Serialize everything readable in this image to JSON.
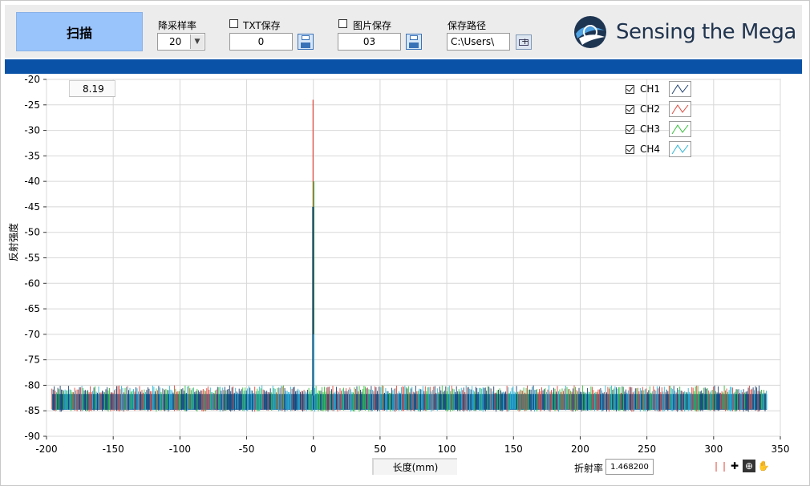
{
  "toolbar": {
    "scan_label": "扫描",
    "downsample_label": "降采样率",
    "downsample_value": "20",
    "txt_save_label": "TXT保存",
    "txt_save_checked": false,
    "txt_counter": "0",
    "img_save_label": "图片保存",
    "img_save_checked": false,
    "img_counter": "03",
    "path_label": "保存路径",
    "path_value": "C:\\Users\\"
  },
  "logo": {
    "text": "Sensing the Mega"
  },
  "colors": {
    "ch1": "#1f3f6e",
    "ch2": "#e0483c",
    "ch3": "#35c03a",
    "ch4": "#2bb6d8",
    "band": "#1d6fa8",
    "header_bar": "#0a52a8",
    "scan_button": "#99c3fb"
  },
  "plot": {
    "cursor_value": "8.19",
    "refractive_index_label": "折射率",
    "refractive_index_value": "1.468200",
    "palette_icons": [
      "cursor-icon",
      "crosshair-icon",
      "zoom-icon",
      "pan-hand-icon"
    ]
  },
  "legend": [
    {
      "label": "CH1",
      "checked": true
    },
    {
      "label": "CH2",
      "checked": true
    },
    {
      "label": "CH3",
      "checked": true
    },
    {
      "label": "CH4",
      "checked": true
    }
  ],
  "chart_data": {
    "type": "line",
    "xlabel": "长度(mm)",
    "ylabel": "反射强度",
    "xlim": [
      -200,
      350
    ],
    "ylim": [
      -90,
      -20
    ],
    "xticks": [
      -200,
      -150,
      -100,
      -50,
      0,
      50,
      100,
      150,
      200,
      250,
      300,
      350
    ],
    "yticks": [
      -20,
      -25,
      -30,
      -35,
      -40,
      -45,
      -50,
      -55,
      -60,
      -65,
      -70,
      -75,
      -80,
      -85,
      -90
    ],
    "grid": true,
    "legend_position": "top-right",
    "noise_floor": {
      "x_range": [
        -196,
        340
      ],
      "y_range": [
        -85,
        -81
      ]
    },
    "peak": {
      "x": 0,
      "y_ch1": -45,
      "y_ch2": -24,
      "y_ch3": -40,
      "y_ch4": -70
    },
    "series": [
      {
        "name": "CH1"
      },
      {
        "name": "CH2"
      },
      {
        "name": "CH3"
      },
      {
        "name": "CH4"
      }
    ]
  }
}
